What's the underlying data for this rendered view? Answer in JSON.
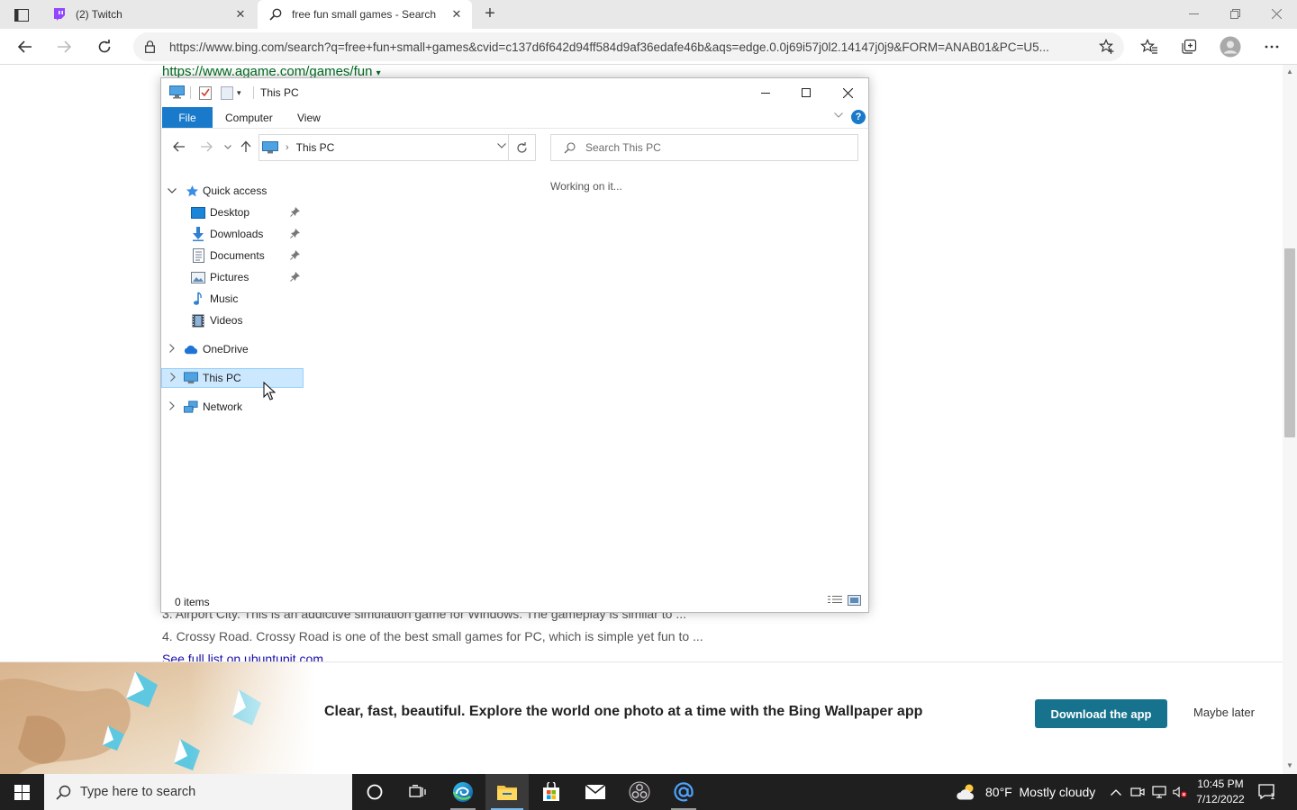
{
  "browser": {
    "tabs": [
      {
        "label": "(2) Twitch",
        "active": false
      },
      {
        "label": "free fun small games - Search",
        "active": true
      }
    ],
    "url": "https://www.bing.com/search?q=free+fun+small+games&cvid=c137d6f642d94ff584d9af36edafe46b&aqs=edge.0.0j69i57j0l2.14147j0j9&FORM=ANAB01&PC=U5..."
  },
  "page": {
    "result_url": "https://www.agame.com/games/fun",
    "snippets": [
      "3. Airport City. This is an addictive simulation game for Windows. The gameplay is similar to ...",
      "4. Crossy Road. Crossy Road is one of the best small games for PC, which is simple yet fun to ..."
    ],
    "see_full": "See full list on ubuntupit.com",
    "banner": {
      "text": "Clear, fast, beautiful. Explore the world one photo at a time with the Bing Wallpaper app",
      "download": "Download the app",
      "maybe": "Maybe later"
    }
  },
  "explorer": {
    "title": "This PC",
    "ribbon": {
      "file": "File",
      "tabs": [
        "Computer",
        "View"
      ],
      "help": "?"
    },
    "address": {
      "crumb": "This PC"
    },
    "search_placeholder": "Search This PC",
    "status_message": "Working on it...",
    "nav": {
      "quick_access": "Quick access",
      "pinned": [
        "Desktop",
        "Downloads",
        "Documents",
        "Pictures"
      ],
      "unpinned": [
        "Music",
        "Videos"
      ],
      "onedrive": "OneDrive",
      "this_pc": "This PC",
      "network": "Network"
    },
    "item_count": "0 items"
  },
  "taskbar": {
    "search_placeholder": "Type here to search",
    "weather": "80°F  Mostly cloudy",
    "time": "10:45 PM",
    "date": "7/12/2022",
    "notification_count": "1"
  },
  "colors": {
    "accent": "#1979ca",
    "selection": "#cce8ff",
    "result_green": "#006d21",
    "download_btn": "#17738d",
    "taskbar": "#1f1f1f"
  }
}
